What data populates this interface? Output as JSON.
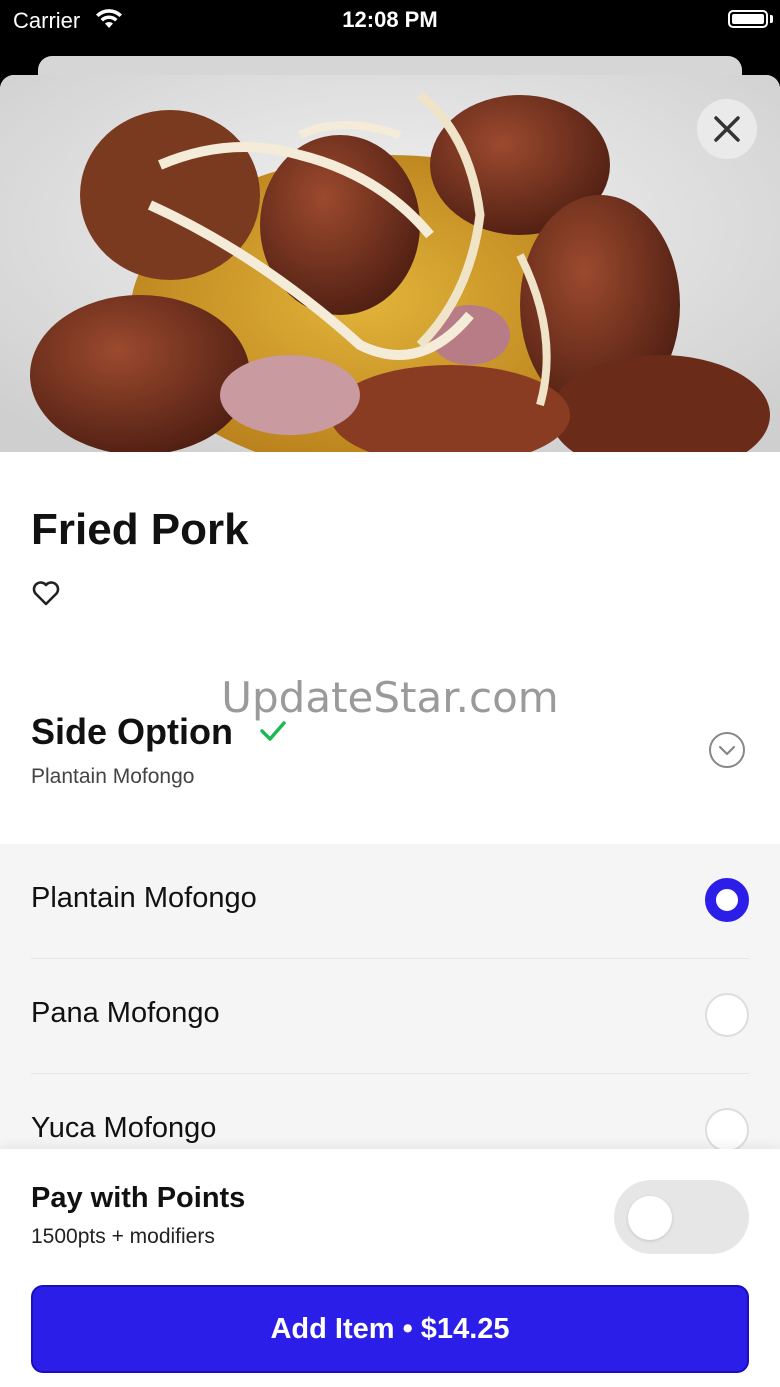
{
  "status_bar": {
    "carrier": "Carrier",
    "time": "12:08 PM"
  },
  "item": {
    "title": "Fried Pork",
    "image_icon": "food-photo"
  },
  "watermark": "UpdateStar.com",
  "side_option": {
    "title": "Side Option",
    "selected_summary": "Plantain Mofongo",
    "options": [
      {
        "label": "Plantain Mofongo",
        "selected": true
      },
      {
        "label": "Pana Mofongo",
        "selected": false
      },
      {
        "label": "Yuca Mofongo",
        "selected": false
      }
    ]
  },
  "footer": {
    "pay_title": "Pay with Points",
    "pay_subtitle": "1500pts + modifiers",
    "add_button": "Add Item • $14.25"
  },
  "colors": {
    "accent": "#2a1ee8",
    "check": "#1db954"
  }
}
